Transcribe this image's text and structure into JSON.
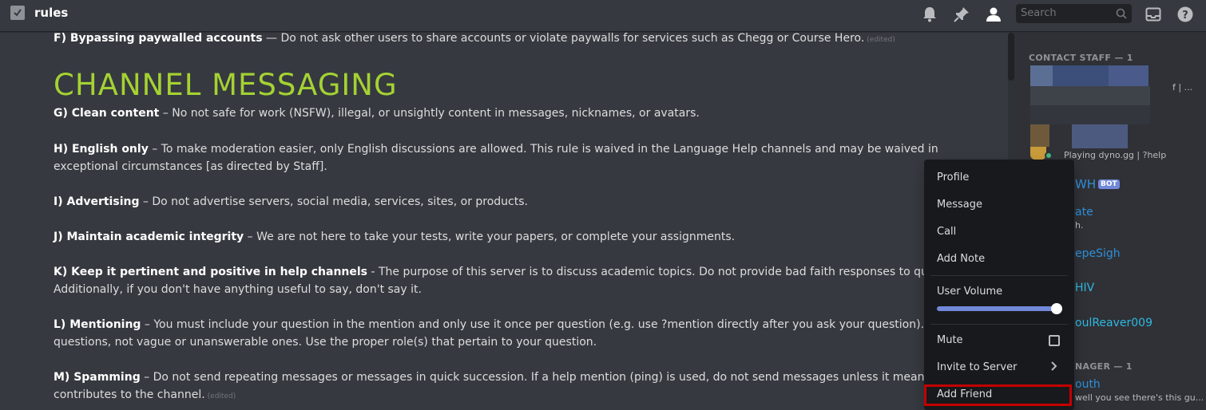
{
  "header": {
    "channel_name": "rules",
    "search_placeholder": "Search"
  },
  "rules": {
    "f": {
      "title": "F) Bypassing paywalled accounts",
      "text": " — Do not ask other users to share accounts or violate paywalls for services such as Chegg or Course Hero.",
      "edited": "(edited)"
    },
    "heading": "CHANNEL MESSAGING",
    "g": {
      "title": "G) Clean content",
      "text": " – No not safe for work (NSFW), illegal, or unsightly content in messages, nicknames, or avatars."
    },
    "h": {
      "title": "H) English only",
      "text": " – To make moderation easier, only English discussions are allowed. This rule is waived in the Language Help channels and may be waived in exceptional circumstances [as directed by Staff]."
    },
    "i": {
      "title": "I) Advertising",
      "text": " – Do not advertise servers, social media, services, sites, or products."
    },
    "j": {
      "title": "J) Maintain academic integrity",
      "text": " – We are not here to take your tests, write your papers, or complete your assignments."
    },
    "k": {
      "title": "K) Keep it pertinent and positive in help channels",
      "text": " - The purpose of this server is to discuss academic topics. Do not provide bad faith responses to questions or requ",
      "text2": "Additionally, if you don't have anything useful to say, don't say it."
    },
    "l": {
      "title": "L) Mentioning",
      "text": " – You must include your question in the mention and only use it once per question (e.g. use ?mention directly after you ask your question). Include spe",
      "text2": "questions, not vague or unanswerable ones. Use the proper role(s) that pertain to your question."
    },
    "m": {
      "title": "M) Spamming",
      "text": " – Do not send repeating messages or messages in quick succession. If a help mention (ping) is used, do not send messages unless it meaningfully",
      "text2": "contributes to the channel.",
      "edited": "(edited)"
    }
  },
  "members": {
    "contact_staff_header": "CONTACT STAFF — 1",
    "partial_1": "f | ...",
    "playing": "Playing dyno.gg | ?help",
    "wh": "WH",
    "bot_tag": "BOT",
    "ate": "ate",
    "ate_sub": "h.",
    "pesigh": "epeSigh",
    "hiv": "HIV",
    "soulreaver": "oulReaver009",
    "manager_header": "NAGER — 1",
    "outh": "outh",
    "outh_sub": "well you see there's this gu..."
  },
  "context_menu": {
    "profile": "Profile",
    "message": "Message",
    "call": "Call",
    "add_note": "Add Note",
    "user_volume": "User Volume",
    "user_volume_level": 1.0,
    "mute": "Mute",
    "invite_to_server": "Invite to Server",
    "add_friend": "Add Friend"
  },
  "colors": {
    "heading": "#a4d233",
    "accent": "#7289da",
    "highlight_border": "#c40000",
    "link_blue": "#2e8fd8",
    "cyan": "#2fb8e3"
  },
  "icons": [
    "channel-rules-icon",
    "bell-icon",
    "pin-icon",
    "members-icon",
    "search-icon",
    "inbox-icon",
    "help-icon",
    "chevron-right-icon"
  ]
}
